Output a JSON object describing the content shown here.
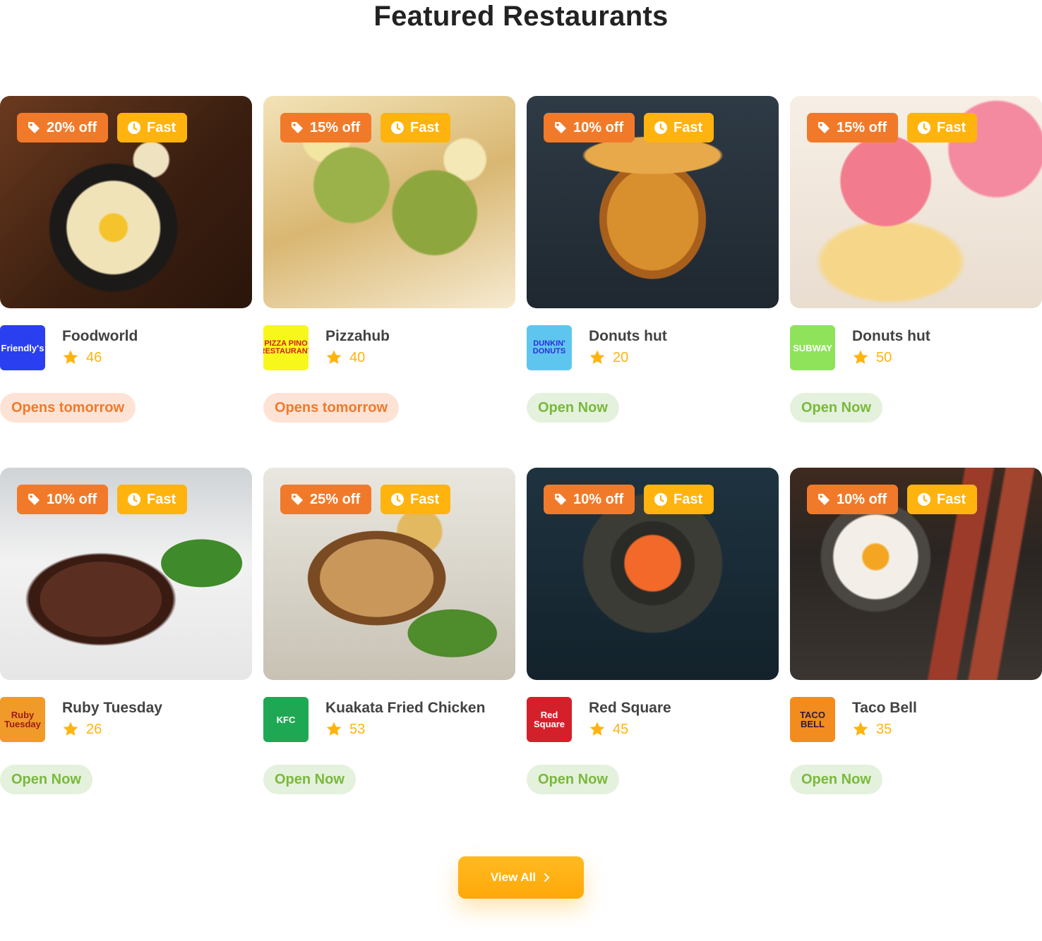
{
  "section": {
    "title": "Featured Restaurants"
  },
  "restaurants": [
    {
      "name": "Foodworld",
      "rating": "46",
      "discount": "20% off",
      "speed": "Fast",
      "status": "Opens tomorrow",
      "status_type": "closed",
      "logo_text": "Friendly's",
      "logo_bg": "#2a3ff0",
      "logo_fg": "#ffffff",
      "photo_theme": "cheese-bowl"
    },
    {
      "name": "Pizzahub",
      "rating": "40",
      "discount": "15% off",
      "speed": "Fast",
      "status": "Opens tomorrow",
      "status_type": "closed",
      "logo_text": "PIZZA PINO RESTAURANT",
      "logo_bg": "#f7f71c",
      "logo_fg": "#d41f1f",
      "photo_theme": "matcha-drink"
    },
    {
      "name": "Donuts hut",
      "rating": "20",
      "discount": "10% off",
      "speed": "Fast",
      "status": "Open Now",
      "status_type": "open",
      "logo_text": "DUNKIN' DONUTS",
      "logo_bg": "#5ec6ee",
      "logo_fg": "#2a2fd8",
      "photo_theme": "pancakes"
    },
    {
      "name": "Donuts hut",
      "rating": "50",
      "discount": "15% off",
      "speed": "Fast",
      "status": "Open Now",
      "status_type": "open",
      "logo_text": "SUBWAY",
      "logo_bg": "#8ee35a",
      "logo_fg": "#ffffff",
      "photo_theme": "cupcakes"
    },
    {
      "name": "Ruby Tuesday",
      "rating": "26",
      "discount": "10% off",
      "speed": "Fast",
      "status": "Open Now",
      "status_type": "open",
      "logo_text": "Ruby Tuesday",
      "logo_bg": "#f09a2a",
      "logo_fg": "#9b1c13",
      "photo_theme": "steak"
    },
    {
      "name": "Kuakata Fried Chicken",
      "rating": "53",
      "discount": "25% off",
      "speed": "Fast",
      "status": "Open Now",
      "status_type": "open",
      "logo_text": "KFC",
      "logo_bg": "#1fa854",
      "logo_fg": "#ffffff",
      "photo_theme": "pork-chop"
    },
    {
      "name": "Red Square",
      "rating": "45",
      "discount": "10% off",
      "speed": "Fast",
      "status": "Open Now",
      "status_type": "open",
      "logo_text": "Red Square",
      "logo_bg": "#d4202a",
      "logo_fg": "#ffffff",
      "photo_theme": "soup"
    },
    {
      "name": "Taco Bell",
      "rating": "35",
      "discount": "10% off",
      "speed": "Fast",
      "status": "Open Now",
      "status_type": "open",
      "logo_text": "TACO BELL",
      "logo_bg": "#f28c1e",
      "logo_fg": "#2a1a3a",
      "photo_theme": "egg-bacon"
    }
  ],
  "view_all": {
    "label": "View All"
  },
  "colors": {
    "accent_orange": "#f17a2a",
    "accent_yellow": "#ffb30e",
    "open_green": "#79b93c"
  }
}
